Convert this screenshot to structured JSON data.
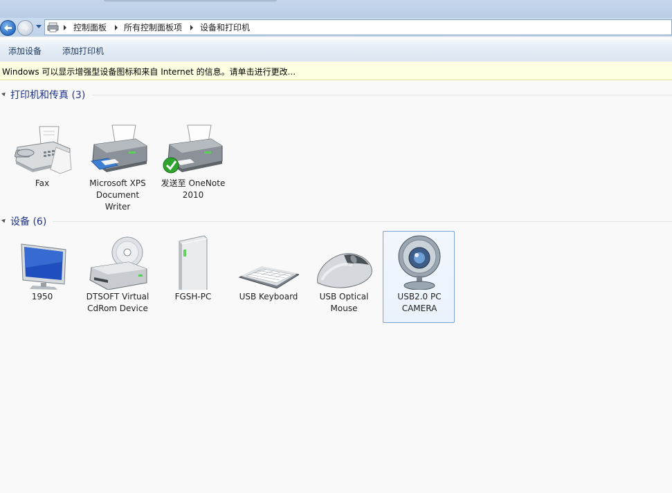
{
  "address": {
    "breadcrumbs": [
      "控制面板",
      "所有控制面板项",
      "设备和打印机"
    ]
  },
  "toolbar": {
    "add_device": "添加设备",
    "add_printer": "添加打印机"
  },
  "infobar": {
    "text": "Windows 可以显示增强型设备图标和来自 Internet 的信息。请单击进行更改..."
  },
  "groups": {
    "printers": {
      "title": "打印机和传真 (3)"
    },
    "devices": {
      "title": "设备 (6)"
    }
  },
  "printers": [
    {
      "label": "Fax",
      "icon": "fax-icon"
    },
    {
      "label": "Microsoft XPS Document Writer",
      "icon": "printer-icon"
    },
    {
      "label": "发送至 OneNote 2010",
      "icon": "printer-default-icon"
    }
  ],
  "devices": [
    {
      "label": "1950",
      "icon": "monitor-icon"
    },
    {
      "label": "DTSOFT Virtual CdRom Device",
      "icon": "cdrom-drive-icon"
    },
    {
      "label": "FGSH-PC",
      "icon": "computer-tower-icon"
    },
    {
      "label": "USB Keyboard",
      "icon": "keyboard-icon"
    },
    {
      "label": "USB Optical Mouse",
      "icon": "mouse-icon"
    },
    {
      "label": "USB2.0 PC CAMERA",
      "icon": "webcam-icon",
      "selected": true
    }
  ],
  "colors": {
    "group_title": "#1e3287",
    "selection_border": "#7da2ce",
    "infobar_bg": "#ffffe1"
  }
}
